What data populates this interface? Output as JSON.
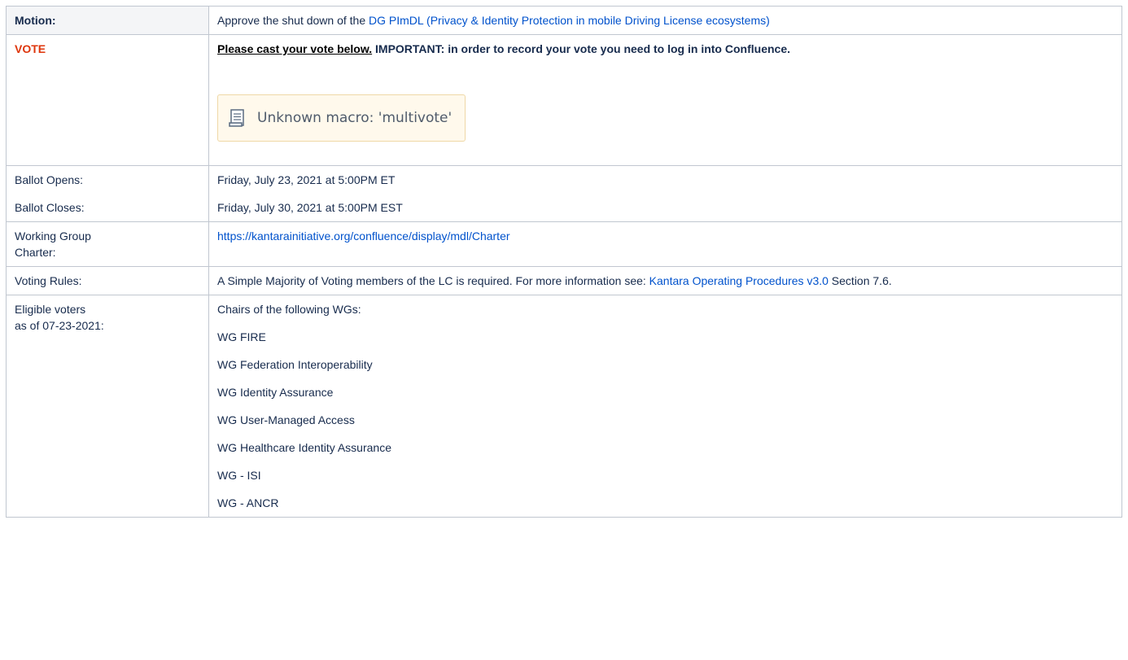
{
  "motion": {
    "label": "Motion:",
    "text_prefix": "Approve the shut down of the ",
    "link_text": "DG PImDL (Privacy & Identity Protection in mobile Driving License ecosystems)"
  },
  "vote": {
    "label": "VOTE",
    "underline_text": "Please cast your vote below.",
    "important_text": " IMPORTANT: in order to record your vote you need to log in into Confluence.",
    "macro_text": "Unknown macro: 'multivote'",
    "macro_icon": "scroll-icon"
  },
  "ballot": {
    "opens_label": "Ballot Opens:",
    "opens_value": "Friday, July 23, 2021 at 5:00PM ET",
    "closes_label": "Ballot Closes:",
    "closes_value": "Friday, July 30, 2021 at 5:00PM EST"
  },
  "charter": {
    "label_line1": "Working Group",
    "label_line2": "Charter:",
    "link": "https://kantarainitiative.org/confluence/display/mdl/Charter"
  },
  "voting_rules": {
    "label": "Voting Rules:",
    "text_prefix": "A Simple Majority of Voting members of the LC is required. For more information see: ",
    "link_text": "Kantara Operating Procedures v3.0",
    "text_suffix": " Section 7.6."
  },
  "eligible": {
    "label_line1": "Eligible voters",
    "label_line2": "as of 07-23-2021:",
    "intro": "Chairs of the following WGs:",
    "groups": [
      "WG FIRE",
      "WG Federation Interoperability",
      "WG Identity Assurance",
      "WG User-Managed Access",
      "WG Healthcare Identity Assurance",
      "WG - ISI",
      "WG - ANCR"
    ]
  },
  "colors": {
    "link": "#0052cc",
    "vote_label": "#de350b",
    "border": "#c1c7d0",
    "header_bg": "#f4f5f7",
    "macro_bg": "#fff9ec",
    "macro_border": "#efd8a6"
  }
}
